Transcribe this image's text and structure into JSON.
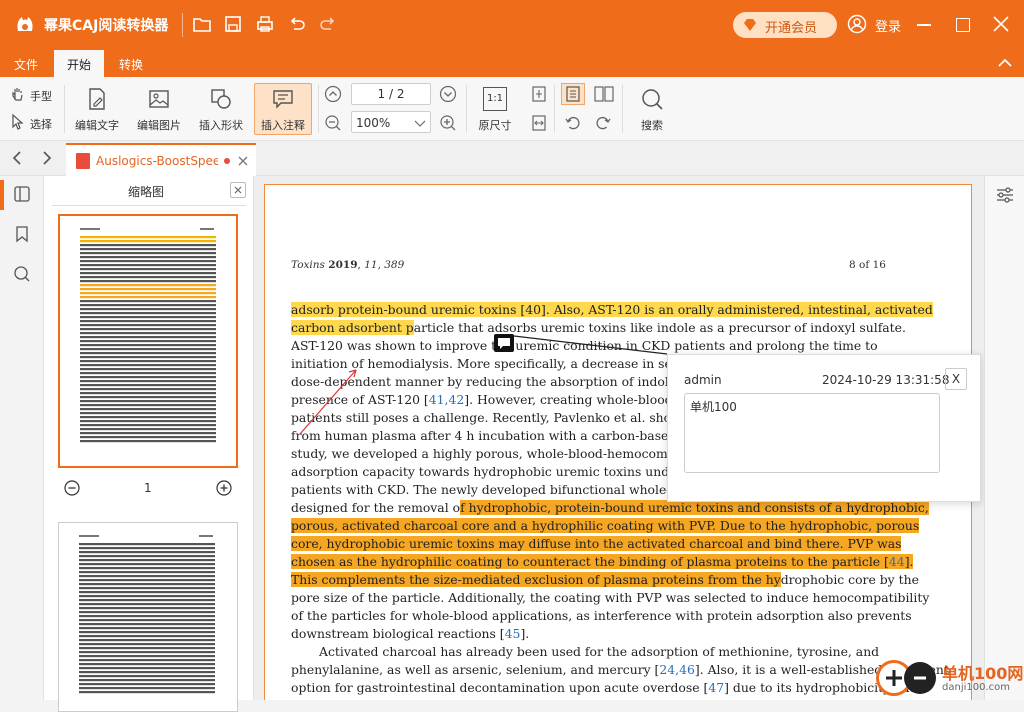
{
  "app": {
    "title": "幂果CAJ阅读转换器",
    "vip_label": "开通会员",
    "login_label": "登录"
  },
  "menu": {
    "file": "文件",
    "start": "开始",
    "convert": "转换"
  },
  "toolbar": {
    "hand": "手型",
    "select": "选择",
    "edit_text": "编辑文字",
    "edit_image": "编辑图片",
    "insert_shape": "插入形状",
    "insert_note": "插入注释",
    "page_indicator": "1 / 2",
    "zoom": "100%",
    "actual_size": "原尺寸",
    "search": "搜索"
  },
  "tab": {
    "name": "Auslogics-BoostSpeed-"
  },
  "thumbnails": {
    "title": "缩略图",
    "page_number": "1"
  },
  "document": {
    "journal": "Toxins",
    "year": "2019",
    "volume_issue": "11, 389",
    "page_of": "8 of 16",
    "lines": [
      [
        "adsorb protein-bound uremic toxins [40]. Also, AST-120 is an orally administered, intestinal, activated",
        "carbon adsorbent particle that adsorbs uremic toxins like indole as a precursor of indoxyl sulfate.",
        "AST-120 was shown to improve the uremic condition in CKD patients and prolong the time to"
      ]
    ],
    "text": {
      "l1": "adsorb protein-bound uremic toxins [40]. Also, AST-120 is an orally administered, intestinal, activated",
      "l2a": "carbon adsorbent p",
      "l2b": "article that adsorbs uremic toxins like indole as a precursor of indoxyl sulfate.",
      "l3": "AST-120 was shown to improve the uremic condition in CKD patients and prolong the time to",
      "l4": "initiation of hemodialysis. More specifically, a decrease in serum",
      "l5": "dose-dependent manner by reducing the absorption of indole fro",
      "l6a": "presence of AST-120 [",
      "l6c": "41,42",
      "l6b": "]. However, creating whole-blood adsor",
      "l7": "patients still poses a challenge. Recently, Pavlenko et al. showed th",
      "l8": "from human plasma after 4 h incubation with a carbon-based adsor",
      "l9": "study, we developed a highly porous, whole-blood-hemocompat",
      "l10": "adsorption capacity towards hydrophobic uremic toxins under fl",
      "l11": "patients with CKD. The newly developed bifunctional whole-blo",
      "l12a": "designed for the removal o",
      "l12b": "f hydrophobic, protein-bound uremic toxins and consists of a hydrophobic,",
      "l13": "porous, activated charcoal core and a hydrophilic coating with PVP. Due to the hydrophobic, porous",
      "l14": "core, hydrophobic uremic toxins may diffuse into the activated charcoal and bind there.  PVP was",
      "l15a": "chosen as the hydrophilic coating to counteract the binding of plasma proteins to the particle [",
      "l15c": "44",
      "l15b": "].",
      "l16a": "This complements the size-mediated exclusion of plasma proteins from the hy",
      "l16b": "drophobic core by the",
      "l17": "pore size of the particle.  Additionally, the coating with PVP was selected to induce hemocompatibility",
      "l18": "of the particles for whole-blood applications, as interference with protein adsorption also prevents",
      "l19a": "downstream biological reactions [",
      "l19c": "45",
      "l19b": "].",
      "l20": "Activated charcoal has already been used for the adsorption of methionine, tyrosine, and",
      "l21a": "phenylalanine, as well as arsenic, selenium, and mercury [",
      "l21c": "24,46",
      "l21b": "].  Also, it is a well-established treatment",
      "l22a": "option for gastrointestinal decontamination upon acute overdose [",
      "l22c": "47",
      "l22b": "] due to its hydrophobicity and"
    }
  },
  "note": {
    "author": "admin",
    "timestamp": "2024-10-29 13:31:58",
    "close": "X",
    "content": "单机100"
  },
  "watermark": {
    "text": "单机100网",
    "url": "danji100.com"
  },
  "colors": {
    "accent": "#ef6c1a",
    "highlight_yellow": "#ffd84d",
    "highlight_orange": "#f5a623"
  }
}
